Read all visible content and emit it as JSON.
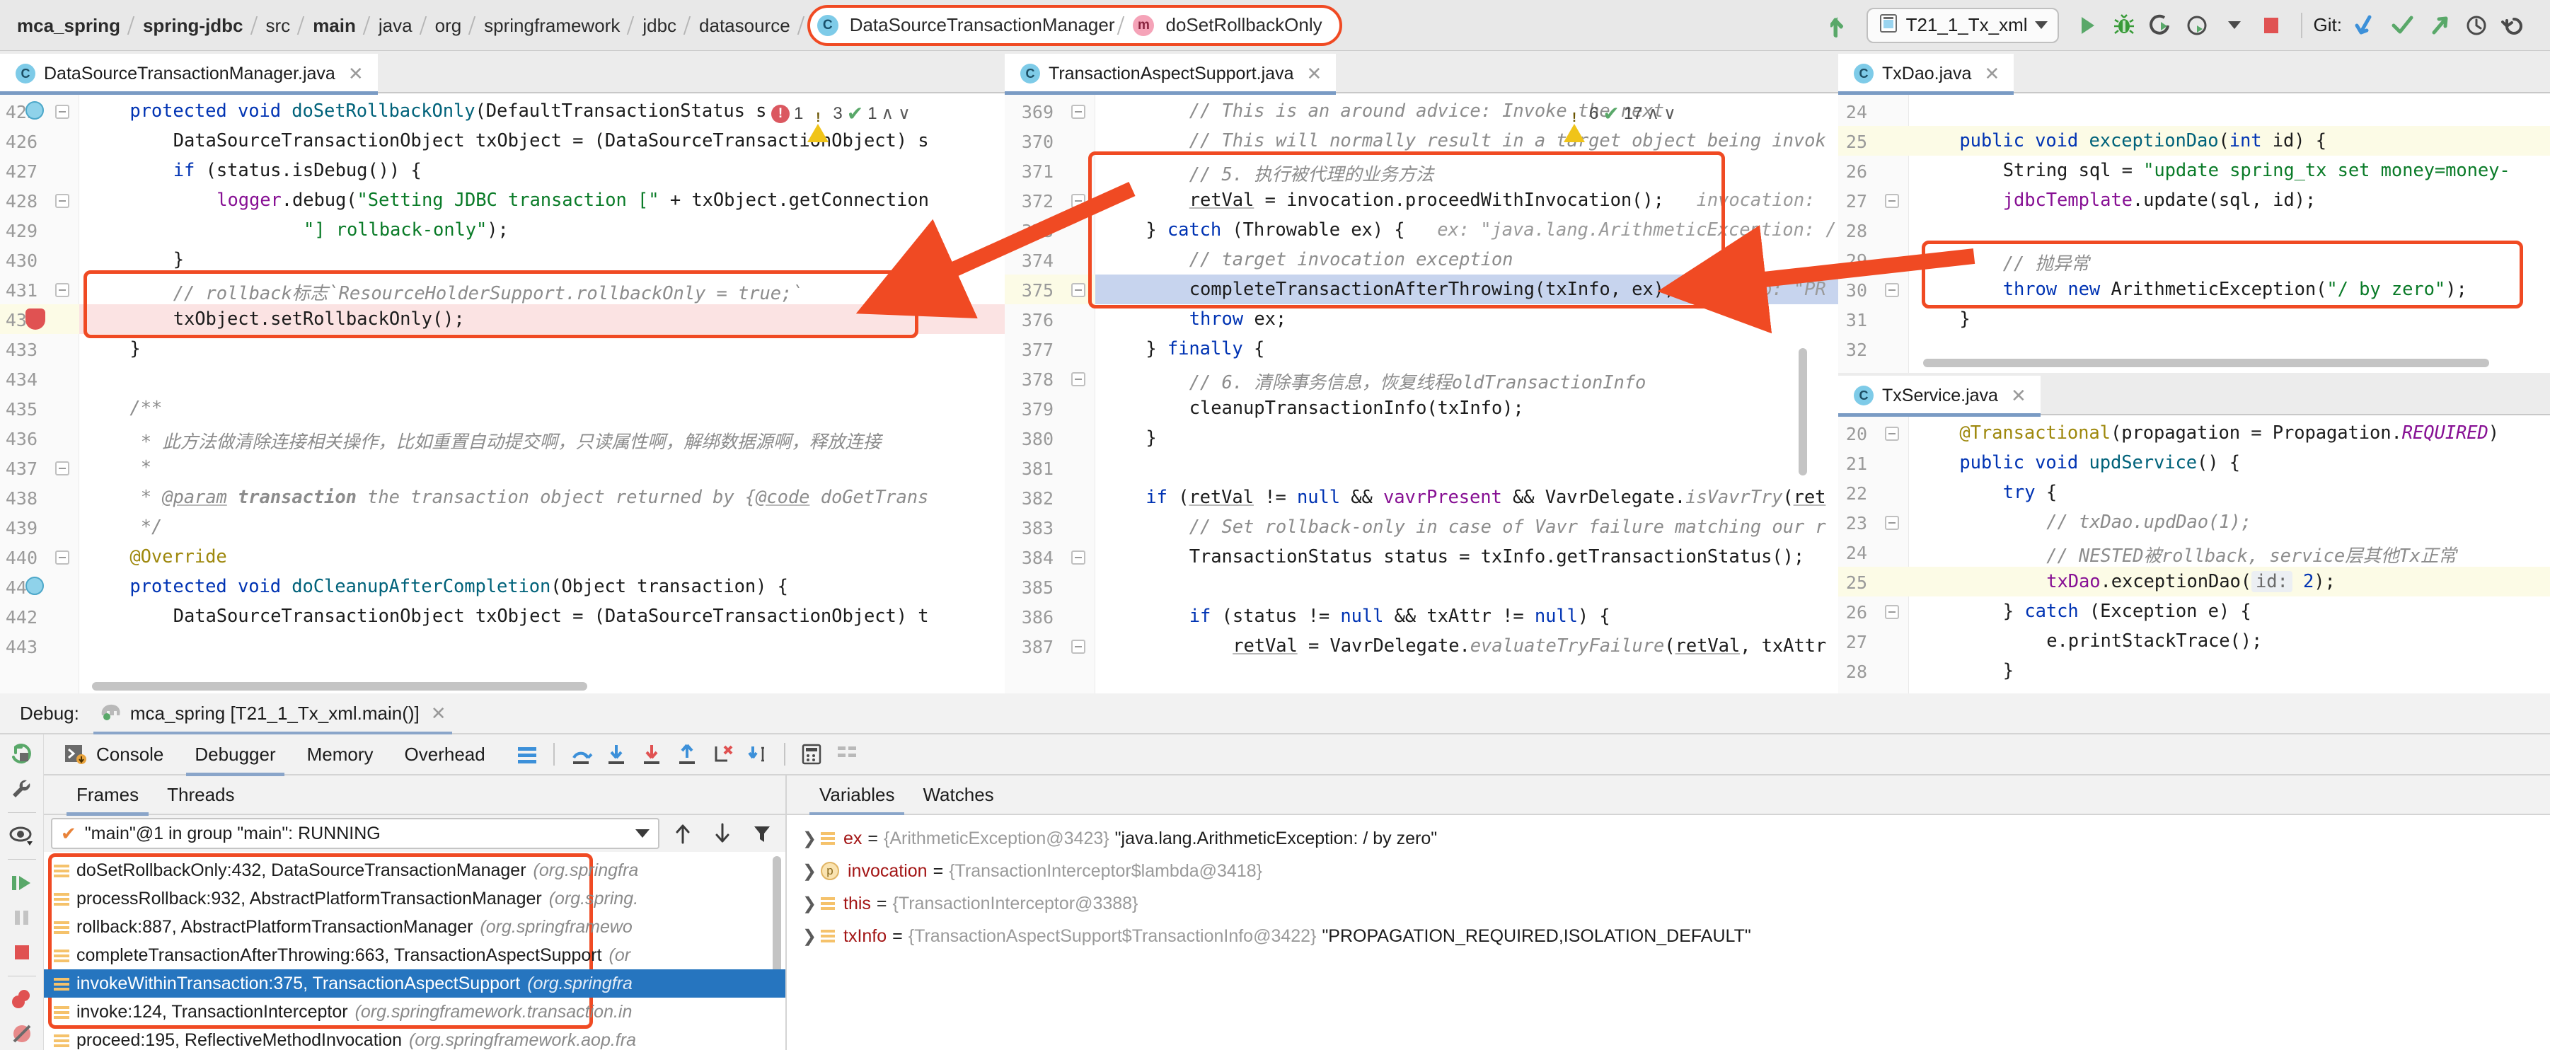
{
  "breadcrumb": {
    "items": [
      {
        "label": "mca_spring",
        "bold": true
      },
      {
        "label": "spring-jdbc",
        "bold": true
      },
      {
        "label": "src",
        "bold": false
      },
      {
        "label": "main",
        "bold": true
      },
      {
        "label": "java",
        "bold": false
      },
      {
        "label": "org",
        "bold": false
      },
      {
        "label": "springframework",
        "bold": false
      },
      {
        "label": "jdbc",
        "bold": false
      },
      {
        "label": "datasource",
        "bold": false
      }
    ],
    "highlighted": {
      "class_name": "DataSourceTransactionManager",
      "class_icon": "C",
      "method_name": "doSetRollbackOnly",
      "method_icon": "m"
    }
  },
  "toolbar": {
    "run_config": "T21_1_Tx_xml",
    "git_label": "Git:",
    "icons": [
      "back-arrow-icon",
      "run-config-icon",
      "run-icon",
      "debug-icon",
      "run-with-coverage-icon",
      "profile-icon",
      "stop-icon",
      "git-update-icon",
      "git-commit-icon",
      "git-push-icon",
      "git-history-icon",
      "git-rollback-icon"
    ]
  },
  "accent_colors": {
    "annotation_red": "#f04a23",
    "tab_underline": "#7a9bc4",
    "selection_blue": "#2675bf",
    "exec_line": "#c7d4ee"
  },
  "editors": {
    "left": {
      "tab": "DataSourceTransactionManager.java",
      "inspections": {
        "errors": "1",
        "warnings": "3",
        "ok": "1"
      },
      "first_line": 425,
      "lines": [
        {
          "n": 425,
          "html": "<span class=\"kw\">protected</span> <span class=\"kw\">void</span> <span class=\"fn\">doSetRollbackOnly</span>(DefaultTransactionStatus s",
          "indent": 4,
          "gutter": "method-marker"
        },
        {
          "n": 426,
          "html": "DataSourceTransactionObject txObject = (DataSourceTransactionObject) s",
          "indent": 8
        },
        {
          "n": 427,
          "html": "<span class=\"kw\">if</span> (status.isDebug()) {",
          "indent": 8
        },
        {
          "n": 428,
          "html": "<span class=\"fld\">logger</span>.debug(<span class=\"str\">\"Setting JDBC transaction [\"</span> + txObject.getConnection",
          "indent": 12
        },
        {
          "n": 429,
          "html": "<span class=\"str\">\"] rollback-only\"</span>);",
          "indent": 20
        },
        {
          "n": 430,
          "html": "}",
          "indent": 8
        },
        {
          "n": 431,
          "html": "<span class=\"cmt\">// rollback标志`ResourceHolderSupport.rollbackOnly = true;`</span>",
          "indent": 8
        },
        {
          "n": 432,
          "html": "txObject.setRollbackOnly();",
          "indent": 8,
          "highlight": "pink",
          "gutter": "breakpoint"
        },
        {
          "n": 433,
          "html": "}",
          "indent": 4
        },
        {
          "n": 434,
          "html": "",
          "indent": 0
        },
        {
          "n": 435,
          "html": "<span class=\"cmt\">/**</span>",
          "indent": 4
        },
        {
          "n": 436,
          "html": "<span class=\"cmt\">* 此方法做清除连接相关操作，比如重置自动提交啊，只读属性啊，解绑数据源啊，释放连接</span>",
          "indent": 5
        },
        {
          "n": 437,
          "html": "<span class=\"cmt\">*</span>",
          "indent": 5
        },
        {
          "n": 438,
          "html": "<span class=\"cmt\">* <span class=\"ulne\">@param</span> <b>transaction</b> the transaction object returned by {<span class=\"ulne\">@code</span> doGetTrans</span>",
          "indent": 5
        },
        {
          "n": 439,
          "html": "<span class=\"cmt\">*/</span>",
          "indent": 5
        },
        {
          "n": 440,
          "html": "<span class=\"ann\">@Override</span>",
          "indent": 4
        },
        {
          "n": 441,
          "html": "<span class=\"kw\">protected</span> <span class=\"kw\">void</span> <span class=\"fn\">doCleanupAfterCompletion</span>(Object transaction) {",
          "indent": 4,
          "gutter": "method-marker"
        },
        {
          "n": 442,
          "html": "DataSourceTransactionObject txObject = (DataSourceTransactionObject) t",
          "indent": 8
        },
        {
          "n": 443,
          "html": "",
          "indent": 0
        }
      ],
      "redbox_lines": [
        431,
        432
      ]
    },
    "middle": {
      "tab": "TransactionAspectSupport.java",
      "inspections": {
        "warnings": "6",
        "ok": "17"
      },
      "first_line": 369,
      "lines": [
        {
          "n": 369,
          "html": "<span class=\"cmt\">// This is an around advice: Invoke the next</span>",
          "indent": 8
        },
        {
          "n": 370,
          "html": "<span class=\"cmt\">// This will normally result in a target object being invok</span>",
          "indent": 8
        },
        {
          "n": 371,
          "html": "<span class=\"cmt\">// 5. 执行被代理的业务方法</span>",
          "indent": 8
        },
        {
          "n": 372,
          "html": "<span class=\"ulne\">retVal</span> = invocation.proceedWithInvocation();<span class=\"hint\">   invocation: </span>",
          "indent": 8
        },
        {
          "n": 373,
          "html": "} <span class=\"kw\">catch</span> (Throwable ex) {<span class=\"hint\">   ex: \"java.lang.ArithmeticException: /</span>",
          "indent": 4
        },
        {
          "n": 374,
          "html": "<span class=\"cmt\">// target invocation exception</span>",
          "indent": 8
        },
        {
          "n": 375,
          "html": "completeTransactionAfterThrowing(txInfo, ex);<span class=\"hint\">   txInfo: \"PR</span>",
          "indent": 8,
          "highlight": "exec"
        },
        {
          "n": 376,
          "html": "<span class=\"kw\">throw</span> ex;",
          "indent": 8
        },
        {
          "n": 377,
          "html": "} <span class=\"kw\">finally</span> {",
          "indent": 4
        },
        {
          "n": 378,
          "html": "<span class=\"cmt\">// 6. 清除事务信息，恢复线程oldTransactionInfo</span>",
          "indent": 8
        },
        {
          "n": 379,
          "html": "cleanupTransactionInfo(txInfo);",
          "indent": 8
        },
        {
          "n": 380,
          "html": "}",
          "indent": 4
        },
        {
          "n": 381,
          "html": "",
          "indent": 0
        },
        {
          "n": 382,
          "html": "<span class=\"kw\">if</span> (<span class=\"ulne\">retVal</span> != <span class=\"kw\">null</span> &amp;&amp; <span class=\"fld\">vavrPresent</span> &amp;&amp; VavrDelegate.<span class=\"cmt\">isVavrTry</span>(<span class=\"ulne\">ret</span>",
          "indent": 4
        },
        {
          "n": 383,
          "html": "<span class=\"cmt\">// Set rollback-only in case of Vavr failure matching our r</span>",
          "indent": 8
        },
        {
          "n": 384,
          "html": "TransactionStatus status = txInfo.getTransactionStatus();",
          "indent": 8
        },
        {
          "n": 385,
          "html": "",
          "indent": 0
        },
        {
          "n": 386,
          "html": "<span class=\"kw\">if</span> (status != <span class=\"kw\">null</span> &amp;&amp; txAttr != <span class=\"kw\">null</span>) {",
          "indent": 8
        },
        {
          "n": 387,
          "html": "<span class=\"ulne\">retVal</span> = VavrDelegate.<span class=\"cmt\">evaluateTryFailure</span>(<span class=\"ulne\">retVal</span>, txAttr",
          "indent": 12
        }
      ],
      "redbox_lines": [
        371,
        372,
        373,
        374,
        375
      ]
    },
    "right_top": {
      "tab": "TxDao.java",
      "first_line": 24,
      "lines": [
        {
          "n": 24,
          "html": "",
          "indent": 0
        },
        {
          "n": 25,
          "html": "<span class=\"kw\">public</span> <span class=\"kw\">void</span> <span class=\"fn\">exceptionDao</span>(<span class=\"kw\">int</span> id) {",
          "indent": 4,
          "highlight": "yellow"
        },
        {
          "n": 26,
          "html": "String sql = <span class=\"str\">\"update spring_tx set money=money-</span>",
          "indent": 8
        },
        {
          "n": 27,
          "html": "<span class=\"fld\">jdbcTemplate</span>.update(sql, id);",
          "indent": 8
        },
        {
          "n": 28,
          "html": "",
          "indent": 0
        },
        {
          "n": 29,
          "html": "<span class=\"cmt\">// 抛异常</span>",
          "indent": 8
        },
        {
          "n": 30,
          "html": "<span class=\"kw\">throw</span> <span class=\"kw\">new</span> ArithmeticException(<span class=\"str\">\"/ by zero\"</span>);",
          "indent": 8
        },
        {
          "n": 31,
          "html": "}",
          "indent": 4
        },
        {
          "n": 32,
          "html": "",
          "indent": 0
        }
      ],
      "redbox_lines": [
        29,
        30
      ]
    },
    "right_bottom": {
      "tab": "TxService.java",
      "first_line": 20,
      "lines": [
        {
          "n": 20,
          "html": "<span class=\"ann\">@Transactional</span>(propagation = Propagation.<span class=\"fld\"><i>REQUIRED</i></span>)",
          "indent": 4
        },
        {
          "n": 21,
          "html": "<span class=\"kw\">public</span> <span class=\"kw\">void</span> <span class=\"fn\">updService</span>() {",
          "indent": 4
        },
        {
          "n": 22,
          "html": "<span class=\"kw\">try</span> {",
          "indent": 8
        },
        {
          "n": 23,
          "html": "<span class=\"cmt\">// txDao.updDao(1);</span>",
          "indent": 12
        },
        {
          "n": 24,
          "html": "<span class=\"cmt\">// NESTED被rollback, service层其他Tx正常</span>",
          "indent": 12
        },
        {
          "n": 25,
          "html": "<span class=\"fld\">txDao</span>.exceptionDao(<span class=\"hintbox\">id:</span> <span class=\"kw\">2</span>);",
          "indent": 12,
          "highlight": "yellow"
        },
        {
          "n": 26,
          "html": "} <span class=\"kw\">catch</span> (Exception e) {",
          "indent": 8
        },
        {
          "n": 27,
          "html": "e.printStackTrace();",
          "indent": 12
        },
        {
          "n": 28,
          "html": "}",
          "indent": 8
        }
      ]
    }
  },
  "debug": {
    "panel_label": "Debug:",
    "session_name": "mca_spring [T21_1_Tx_xml.main()]",
    "session_icon": "elephant-icon",
    "tabs": [
      {
        "label": "Console",
        "active": false,
        "icon": "console-icon"
      },
      {
        "label": "Debugger",
        "active": true,
        "icon": null
      },
      {
        "label": "Memory",
        "active": false,
        "icon": null
      },
      {
        "label": "Overhead",
        "active": false,
        "icon": null
      }
    ],
    "tool_icons": [
      "layout-icon",
      "step-over-icon",
      "step-into-icon",
      "force-step-into-icon",
      "step-out-icon",
      "drop-frame-icon",
      "run-to-cursor-icon",
      "evaluate-expression-icon",
      "mute-breakpoints-icon"
    ],
    "side_icons": [
      "rerun-icon",
      "settings-icon",
      "watch-icon",
      "resume-icon",
      "pause-icon",
      "stop-icon",
      "view-breakpoints-icon",
      "mute-breakpoints-icon"
    ],
    "frames_tabs": [
      {
        "label": "Frames",
        "active": true
      },
      {
        "label": "Threads",
        "active": false
      }
    ],
    "thread_selector": {
      "value": "\"main\"@1 in group \"main\": RUNNING",
      "status_icon": "check-icon"
    },
    "frame_tools": [
      "up-arrow-icon",
      "down-arrow-icon",
      "filter-icon"
    ],
    "frames": [
      {
        "method": "doSetRollbackOnly:432, DataSourceTransactionManager",
        "pkg": "(org.springfra",
        "selected": false
      },
      {
        "method": "processRollback:932, AbstractPlatformTransactionManager",
        "pkg": "(org.spring.",
        "selected": false
      },
      {
        "method": "rollback:887, AbstractPlatformTransactionManager",
        "pkg": "(org.springframewo",
        "selected": false
      },
      {
        "method": "completeTransactionAfterThrowing:663, TransactionAspectSupport",
        "pkg": "(or",
        "selected": false
      },
      {
        "method": "invokeWithinTransaction:375, TransactionAspectSupport",
        "pkg": "(org.springfra",
        "selected": true
      },
      {
        "method": "invoke:124, TransactionInterceptor",
        "pkg": "(org.springframework.transaction.in",
        "selected": false
      },
      {
        "method": "proceed:195, ReflectiveMethodInvocation",
        "pkg": "(org.springframework.aop.fra",
        "selected": false
      }
    ],
    "variables_tabs": [
      {
        "label": "Variables",
        "active": true
      },
      {
        "label": "Watches",
        "active": false
      }
    ],
    "variables": [
      {
        "name": "ex",
        "kind": "field",
        "ref": "{ArithmeticException@3423}",
        "value": "\"java.lang.ArithmeticException: / by zero\""
      },
      {
        "name": "invocation",
        "kind": "param",
        "ref": "{TransactionInterceptor$lambda@3418}",
        "value": ""
      },
      {
        "name": "this",
        "kind": "field",
        "ref": "{TransactionInterceptor@3388}",
        "value": ""
      },
      {
        "name": "txInfo",
        "kind": "field",
        "ref": "{TransactionAspectSupport$TransactionInfo@3422}",
        "value": "\"PROPAGATION_REQUIRED,ISOLATION_DEFAULT\""
      }
    ]
  }
}
